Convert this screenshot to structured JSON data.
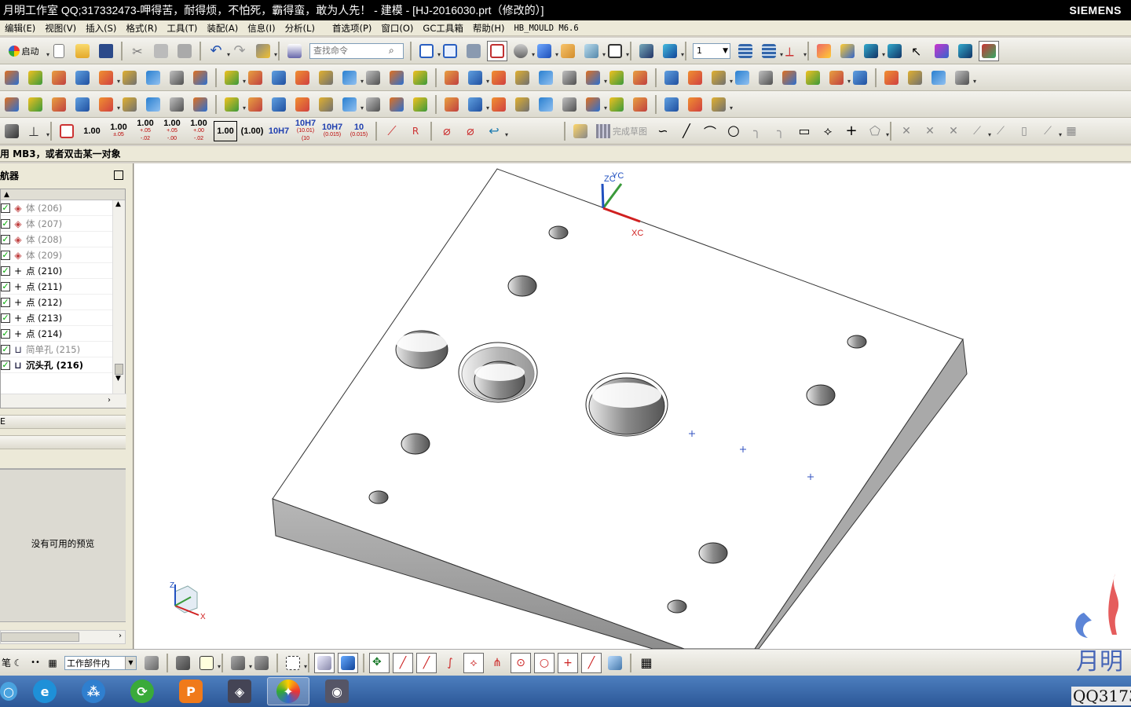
{
  "window": {
    "title": "月明工作室 QQ;317332473-呷得苦，耐得烦，不怕死，霸得蛮，敢为人先！ - 建模 - [HJ-2016030.prt（修改的）]",
    "brand": "SIEMENS"
  },
  "menu": [
    "编辑(E)",
    "视图(V)",
    "插入(S)",
    "格式(R)",
    "工具(T)",
    "装配(A)",
    "信息(I)",
    "分析(L)",
    "首选项(P)",
    "窗口(O)",
    "GC工具箱",
    "帮助(H)",
    "HB_MOULD M6.6"
  ],
  "toolbar1": {
    "start_label": "启动",
    "search_placeholder": "查找命令",
    "layer_value": "1"
  },
  "toolbar4": {
    "dims": [
      {
        "main": "1.00",
        "sub": ""
      },
      {
        "main": "1.00",
        "sub": "±.05"
      },
      {
        "main": "1.00",
        "sub": "+.05 -.02"
      },
      {
        "main": "1.00",
        "sub": "+.05 -.00"
      },
      {
        "main": "1.00",
        "sub": "+.00 -.02"
      },
      {
        "main": "1.00",
        "sub": ""
      },
      {
        "main": "(1.00)",
        "sub": ""
      },
      {
        "main": "10H7",
        "sub": ""
      },
      {
        "main": "10H7",
        "sub": "(10.01) (10"
      },
      {
        "main": "10H7",
        "sub": "(0.015)"
      },
      {
        "main": "10",
        "sub": "(0.015)"
      }
    ],
    "finish_sketch_label": "完成草图"
  },
  "cue_line": "用 MB3，或者双击某一对象",
  "navigator": {
    "title": "航器",
    "items": [
      {
        "icon": "body",
        "label": "体 (206)",
        "dim": true,
        "bold": false
      },
      {
        "icon": "body",
        "label": "体 (207)",
        "dim": true,
        "bold": false
      },
      {
        "icon": "body",
        "label": "体 (208)",
        "dim": true,
        "bold": false
      },
      {
        "icon": "body",
        "label": "体 (209)",
        "dim": true,
        "bold": false
      },
      {
        "icon": "point",
        "label": "点 (210)",
        "dim": false,
        "bold": false
      },
      {
        "icon": "point",
        "label": "点 (211)",
        "dim": false,
        "bold": false
      },
      {
        "icon": "point",
        "label": "点 (212)",
        "dim": false,
        "bold": false
      },
      {
        "icon": "point",
        "label": "点 (213)",
        "dim": false,
        "bold": false
      },
      {
        "icon": "point",
        "label": "点 (214)",
        "dim": false,
        "bold": false
      },
      {
        "icon": "hole",
        "label": "简单孔 (215)",
        "dim": true,
        "bold": false
      },
      {
        "icon": "cbore",
        "label": "沉头孔 (216)",
        "dim": false,
        "bold": true
      }
    ],
    "section1_label": "E",
    "preview_text": "没有可用的预览"
  },
  "viewport": {
    "csys_labels": {
      "zc": "ZC",
      "yc": "YC",
      "xc": "XC"
    },
    "triad_labels": {
      "z": "Z",
      "x": "X"
    }
  },
  "statusbar": {
    "filter_value": "工作部件内",
    "left_label": "笔"
  },
  "watermark": {
    "text": "QQ3173",
    "logo_text": "月明"
  },
  "colors": {
    "titlebar": "#000000",
    "menubar": "#ece9d8",
    "viewport_bg": "#ffffff",
    "taskbar": "#2b5797",
    "check": "#00aa00"
  }
}
